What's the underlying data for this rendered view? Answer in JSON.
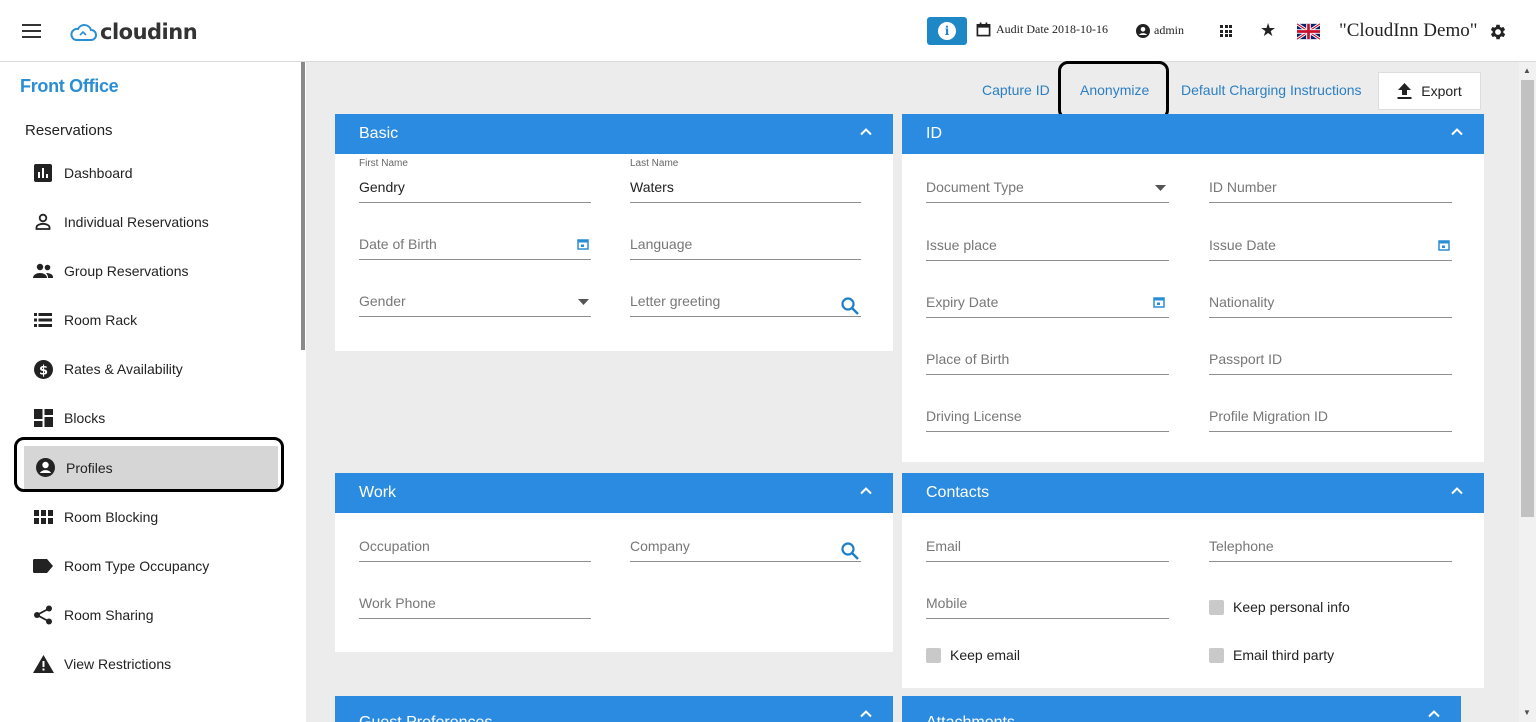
{
  "app": {
    "logo_text": "cloudinn",
    "audit_date": "Audit Date 2018-10-16",
    "user": "admin",
    "property": "\"CloudInn Demo\""
  },
  "sidebar": {
    "section": "Front Office",
    "group": "Reservations",
    "items": [
      {
        "label": "Dashboard",
        "icon": "bar-chart-icon"
      },
      {
        "label": "Individual Reservations",
        "icon": "person-icon"
      },
      {
        "label": "Group Reservations",
        "icon": "group-icon"
      },
      {
        "label": "Room Rack",
        "icon": "list-icon"
      },
      {
        "label": "Rates & Availability",
        "icon": "dollar-icon"
      },
      {
        "label": "Blocks",
        "icon": "dashboard-icon"
      },
      {
        "label": "Profiles",
        "icon": "account-circle-icon",
        "active": true
      },
      {
        "label": "Room Blocking",
        "icon": "grid-icon"
      },
      {
        "label": "Room Type Occupancy",
        "icon": "label-icon"
      },
      {
        "label": "Room Sharing",
        "icon": "share-icon"
      },
      {
        "label": "View Restrictions",
        "icon": "warning-icon"
      }
    ]
  },
  "actions": {
    "capture_id": "Capture ID",
    "anonymize": "Anonymize",
    "default_charging": "Default Charging Instructions",
    "export": "Export"
  },
  "basic": {
    "title": "Basic",
    "first_name_label": "First Name",
    "first_name": "Gendry",
    "last_name_label": "Last Name",
    "last_name": "Waters",
    "dob": "Date of Birth",
    "language": "Language",
    "gender": "Gender",
    "letter_greeting": "Letter greeting"
  },
  "id": {
    "title": "ID",
    "document_type": "Document Type",
    "id_number": "ID Number",
    "issue_place": "Issue place",
    "issue_date": "Issue Date",
    "expiry_date": "Expiry Date",
    "nationality": "Nationality",
    "place_of_birth": "Place of Birth",
    "passport_id": "Passport ID",
    "driving_license": "Driving License",
    "profile_migration_id": "Profile Migration ID"
  },
  "work": {
    "title": "Work",
    "occupation": "Occupation",
    "company": "Company",
    "work_phone": "Work Phone"
  },
  "contacts": {
    "title": "Contacts",
    "email": "Email",
    "telephone": "Telephone",
    "mobile": "Mobile",
    "keep_personal_info": "Keep personal info",
    "email_third_party": "Email third party",
    "keep_email": "Keep email"
  },
  "guest_preferences": {
    "title": "Guest Preferences"
  },
  "attachments": {
    "title": "Attachments"
  },
  "colors": {
    "accent": "#2b8be0",
    "link": "#2a7fc4",
    "sidebar_title": "#2a8ed4"
  }
}
